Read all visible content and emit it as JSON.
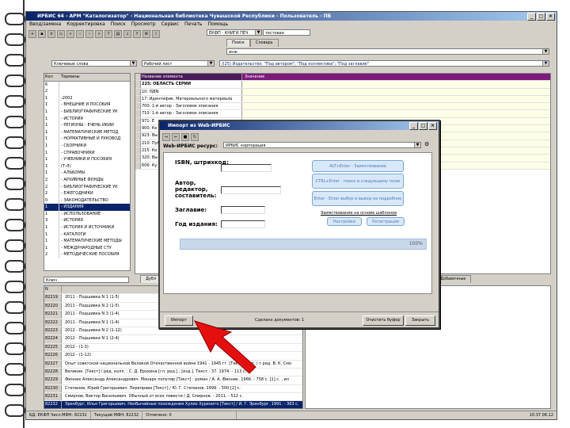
{
  "app": {
    "title": "ИРБИС 64 - АРМ \"Каталогизатор\" - Национальная библиотека Чувашской Республики - Пользователь - ПБ",
    "menu": [
      "Ввод/замена",
      "Корректировка",
      "Поиск",
      "Просмотр",
      "Сервис",
      "Печать",
      "Помощь"
    ],
    "db_field": "ЕКФП - КНИГИ ПЕЧ",
    "db_extra": "тестовая",
    "tabs_right": [
      "Поиск",
      "Словарь"
    ],
    "search_value": "инж",
    "left_select": "Ключевые слова",
    "mid_select": "Рабочий лист",
    "format_select": "Полный формат",
    "right_expr": "/(25) Издательство: \"Под автором\"; \"Под коллектива\"; \"Под заглавие\""
  },
  "dictionary": {
    "headers": [
      "Кол",
      "Термины"
    ],
    "rows": [
      {
        "n": "6",
        "t": ""
      },
      {
        "n": "2",
        "t": ""
      },
      {
        "n": "1",
        "t": "-2002"
      },
      {
        "n": "1",
        "t": "- ВНЕШНИЕ И ПОСОБИЯ"
      },
      {
        "n": "1",
        "t": "- БИБЛИОГРАФИЧЕСКИЕ УК"
      },
      {
        "n": "1",
        "t": "- ИСТОРИЯ"
      },
      {
        "n": "1",
        "t": "- РЕГИОНЫ - ЕЧЕНЬ ИКИИ"
      },
      {
        "n": "1",
        "t": "- МАТЕМАТИЧЕСКИЕ МЕТОД"
      },
      {
        "n": "1",
        "t": "- НОРМАТИВНЫЕ И РУКОВОД"
      },
      {
        "n": "1",
        "t": "- СБОРНИКИ"
      },
      {
        "n": "1",
        "t": "- СПРАВОЧНИКИ"
      },
      {
        "n": "1",
        "t": "- УЧЕБНИКИ И ПОСОБИЯ"
      },
      {
        "n": "1",
        "t": "(Т-Л)"
      },
      {
        "n": "1",
        "t": "- АЛЬБОМЫ"
      },
      {
        "n": "2",
        "t": "- АРХИВНЫЕ ФОНДЫ"
      },
      {
        "n": "2",
        "t": "- БИБЛИОГРАФИЧЕСКИЕ УК"
      },
      {
        "n": "2",
        "t": "- ЕЖЕГОДНИКИ"
      },
      {
        "n": "0",
        "t": "- ЗАКОНОДАТЕЛЬСТВО"
      },
      {
        "n": "1",
        "t": "- ИЗДАНИЯ"
      },
      {
        "n": "1",
        "t": "- ИСПОЛЬЗОВАНИЕ"
      },
      {
        "n": "3",
        "t": "- ИСТОРИЯ"
      },
      {
        "n": "1",
        "t": "- ИСТОРИЯ И ИСТОЧНИКИ"
      },
      {
        "n": "1",
        "t": "- КАТАЛОГИ"
      },
      {
        "n": "1",
        "t": "- МАТЕМАТИЧЕСКИЕ МЕТОДЫ"
      },
      {
        "n": "1",
        "t": "- МЕЖДУНАРОДНЫЕ СТУ"
      },
      {
        "n": "2",
        "t": "- МЕТОДИЧЕСКИЕ ПОСОБИЯ"
      }
    ],
    "selected_index": 18,
    "bottom_label": "Ключ"
  },
  "worksheet": {
    "headers": [
      "Название элемента",
      "Значение"
    ],
    "rows": [
      "225: ОБЛАСТЬ СЕРИИ",
      "10: ISBN",
      "17: Идентифик. Материального материала",
      "700: 1-й автор - Заголовок описания",
      "710: 1-й автор - Заголовок описания",
      "971: Е",
      "900: Ко",
      "923: Вы",
      "210: Пуб",
      "215: Ко",
      "320: Вы",
      "606: Ку"
    ],
    "bottom_tabs": [
      "Дубл",
      "Добавочные"
    ]
  },
  "records": {
    "header": "N",
    "rows": [
      {
        "n": "82219",
        "t": "2011 - Подшивка N 1 (1-5)"
      },
      {
        "n": "82220",
        "t": "2011 - Подшивка N 2 (1-5)"
      },
      {
        "n": "82221",
        "t": "2011 - Подшивка N 3 (1-4)"
      },
      {
        "n": "82222",
        "t": "2011 - Подшивка N 1 (1-4)"
      },
      {
        "n": "82223",
        "t": "2012 - Подшивка N 2 (1-12)"
      },
      {
        "n": "82224",
        "t": "2012 - Подшивка N 1 (2-4)"
      },
      {
        "n": "82225",
        "t": "2012 - (1-3)"
      },
      {
        "n": "82226",
        "t": "2012 - (1-12)"
      },
      {
        "n": "82227",
        "t": "Опыт советской национальной Великой Отечественной войне 1941 - 1945 гг. [Текст] : 1 т. / т ред. В. К. Смо"
      },
      {
        "n": "82228",
        "t": "Великие. [Текст] / ред. колл. : С. Д. Ерохина [гл. ред.] ; [изд.]. Текст : 37. 1974. - 113 с."
      },
      {
        "n": "82229",
        "t": "Финник Александр Александрович. Монарх популяр [Текст] : роман / А. А. Финник. 1966. - 758 с. [1] с. : ил"
      },
      {
        "n": "82230",
        "t": "Степанов, Юрий Григорьевич. Переправа [Текст] / Ю. Г. Степанов. 1999. - 500 [2] с."
      },
      {
        "n": "82231",
        "t": "Смирнов, Виктор Васильевич. Обычный от всех повести / Д. Смирнов. - 2011. - 512 с."
      },
      {
        "n": "82232",
        "t": "Эренбург, Илья Григорьевич. Необычайные похождения Хулио Хуренито [Текст] / И. Г. Эренбург. 1991. - 363 с."
      }
    ],
    "selected_index": 13
  },
  "statusbar": [
    "БД: ЕКФП Числ.МФН: 82232",
    "Текущий МФН: 82232",
    "Отмечено: 0",
    "10:37 06.12"
  ],
  "dialog": {
    "title": "Импорт из Web-ИРБИС",
    "source_label": "Web-ИРБИС ресурс:",
    "source_value": "ИРБИС корпорация",
    "fields": [
      "ISBN, штрихкод:",
      "Автор, редактор, составитель:",
      "Заглавие:",
      "Год издания:"
    ],
    "actions": [
      "АLT+Enter - Заимствование",
      "CTRL+Enter - поиск и следующему полю",
      "Enter - Enter выбор и вывод на подробное"
    ],
    "note": "Заимствование на основе шаблонов",
    "small_buttons": [
      "Настройки",
      "Регистрация"
    ],
    "progress_label": "100%",
    "progress": 1.0,
    "footer_left": "Импорт",
    "footer_count": "Сделано документов: 1",
    "footer_buttons": [
      "Очистить буфер",
      "Закрыть"
    ]
  }
}
